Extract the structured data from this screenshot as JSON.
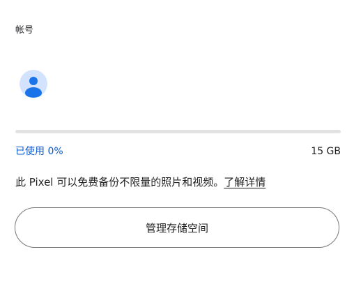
{
  "section": {
    "title": "帐号"
  },
  "account": {
    "name": "",
    "avatar_icon": "person-icon",
    "avatar_color": "#d3e3fd",
    "avatar_figure_color": "#1a73e8"
  },
  "storage": {
    "used_label": "已使用 0%",
    "used_fraction": 0,
    "total_label": "15 GB",
    "description": "此 Pixel 可以免费备份不限量的照片和视频。",
    "learn_more_label": "了解详情",
    "manage_label": "管理存储空间",
    "accent_color": "#0b57d0"
  }
}
